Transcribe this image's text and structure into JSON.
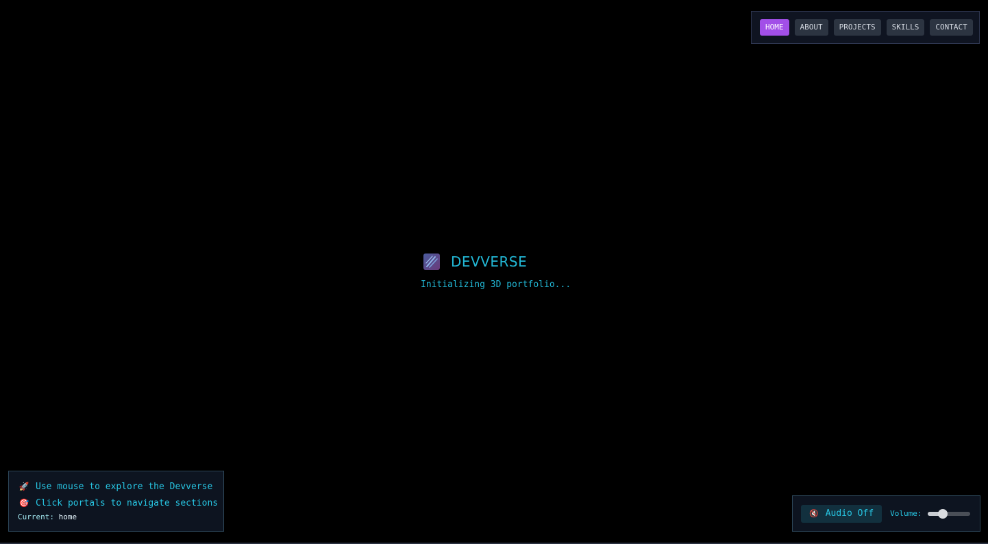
{
  "nav": {
    "items": [
      {
        "label": "HOME",
        "active": true
      },
      {
        "label": "ABOUT",
        "active": false
      },
      {
        "label": "PROJECTS",
        "active": false
      },
      {
        "label": "SKILLS",
        "active": false
      },
      {
        "label": "CONTACT",
        "active": false
      }
    ]
  },
  "loader": {
    "logo_icon": "comet-icon",
    "brand": "DEVVERSE",
    "status": "Initializing 3D portfolio..."
  },
  "help": {
    "line1": {
      "icon": "🚀",
      "icon_name": "rocket-icon",
      "text": "Use mouse to explore the Devverse"
    },
    "line2": {
      "icon": "🎯",
      "icon_name": "target-icon",
      "text": "Click portals to navigate sections"
    },
    "current_label": "Current:",
    "current_value": "home"
  },
  "audio": {
    "icon": "🔇",
    "icon_name": "mute-icon",
    "button_label": "Audio Off",
    "volume_label": "Volume:",
    "volume": 0.35
  },
  "colors": {
    "accent": "#22b8d6",
    "active_nav": "#a24fe8",
    "background": "#000000"
  }
}
